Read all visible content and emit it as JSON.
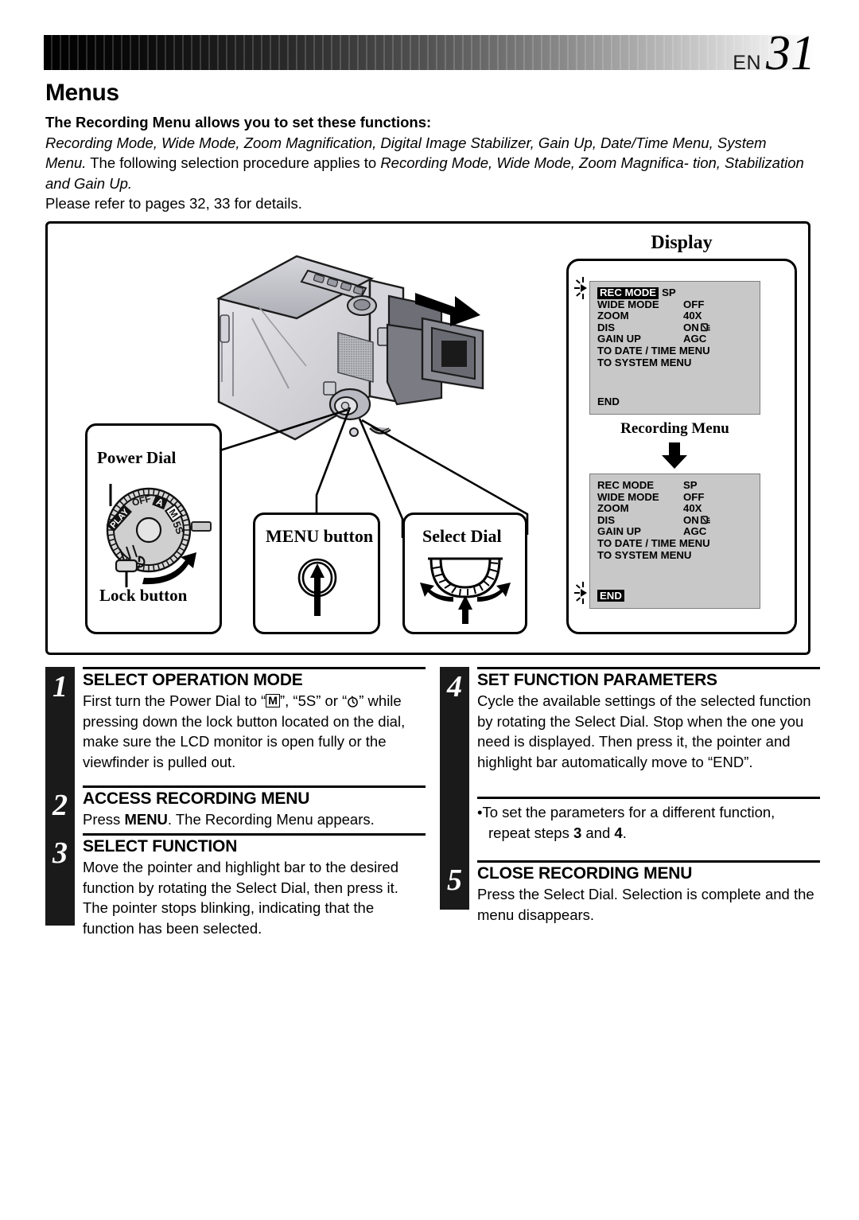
{
  "header": {
    "lang_code": "EN",
    "page_number": "31"
  },
  "page_title": "Menus",
  "intro": {
    "lead": "The Recording Menu allows you to set these functions:",
    "line1_italic": "Recording Mode, Wide Mode, Zoom Magnification, Digital Image Stabilizer, Gain Up, Date/Time Menu,",
    "line2_italic_a": "System Menu.",
    "line2_plain": " The following selection procedure applies to ",
    "line2_italic_b": "Recording Mode, Wide Mode, Zoom Magnifica-",
    "line3_italic": "tion, Stabilization and Gain Up.",
    "line4": "Please refer to pages 32, 33 for details."
  },
  "illustration": {
    "display_label": "Display",
    "recording_menu_caption": "Recording Menu",
    "callouts": {
      "power_dial": "Power Dial",
      "lock_button": "Lock button",
      "menu_button": "MENU button",
      "select_dial": "Select Dial"
    },
    "power_dial_positions": [
      "PLAY",
      "OFF",
      "A",
      "M",
      "5S"
    ],
    "power_dial_power_symbol": "power-icon"
  },
  "menu_screen_1": {
    "rows": [
      {
        "label": "REC MODE",
        "value": "SP",
        "highlighted": true,
        "wide": false
      },
      {
        "label": "WIDE MODE",
        "value": "OFF",
        "highlighted": false,
        "wide": false
      },
      {
        "label": "ZOOM",
        "value": "40X",
        "highlighted": false,
        "wide": false
      },
      {
        "label": "DIS",
        "value": "ON",
        "icon": "dis-hand-icon",
        "highlighted": false,
        "wide": false
      },
      {
        "label": "GAIN UP",
        "value": "AGC",
        "highlighted": false,
        "wide": false
      },
      {
        "label": "TO DATE / TIME MENU",
        "value": "",
        "highlighted": false,
        "wide": true
      },
      {
        "label": "TO SYSTEM MENU",
        "value": "",
        "highlighted": false,
        "wide": true
      }
    ],
    "end_label": "END",
    "end_highlighted": false,
    "pointer_on": "REC MODE"
  },
  "menu_screen_2": {
    "rows": [
      {
        "label": "REC MODE",
        "value": "SP",
        "highlighted": false,
        "wide": false
      },
      {
        "label": "WIDE MODE",
        "value": "OFF",
        "highlighted": false,
        "wide": false
      },
      {
        "label": "ZOOM",
        "value": "40X",
        "highlighted": false,
        "wide": false
      },
      {
        "label": "DIS",
        "value": "ON",
        "icon": "dis-hand-icon",
        "highlighted": false,
        "wide": false
      },
      {
        "label": "GAIN UP",
        "value": "AGC",
        "highlighted": false,
        "wide": false
      },
      {
        "label": "TO DATE / TIME MENU",
        "value": "",
        "highlighted": false,
        "wide": true
      },
      {
        "label": "TO SYSTEM MENU",
        "value": "",
        "highlighted": false,
        "wide": true
      }
    ],
    "end_label": "END",
    "end_highlighted": true,
    "pointer_on": "END"
  },
  "steps_left": [
    {
      "number": "1",
      "heading": "SELECT OPERATION MODE",
      "text_pre": "First turn the Power Dial to “",
      "text_mid1": "”, “5S” or “",
      "text_post": "” while pressing down the lock button located on the dial, make sure the LCD monitor is open fully or the viewfinder is pulled out.",
      "mode_box": "M"
    },
    {
      "number": "2",
      "heading": "ACCESS RECORDING MENU",
      "text_pre": "Press ",
      "bold_word": "MENU",
      "text_post": ". The Recording Menu appears."
    },
    {
      "number": "3",
      "heading": "SELECT FUNCTION",
      "text": "Move the pointer and highlight bar to the desired function by rotating the Select Dial, then press it. The pointer stops blinking, indicating that the function has been selected."
    }
  ],
  "steps_right": [
    {
      "number": "4",
      "heading": "SET FUNCTION PARAMETERS",
      "text": "Cycle the available settings of the selected function by rotating the Select Dial. Stop when the one you need is displayed. Then press it, the pointer and highlight bar automatically move to “END”."
    },
    {
      "number": "5",
      "heading": "CLOSE RECORDING MENU",
      "text": "Press the Select Dial. Selection is complete and the menu disappears."
    }
  ],
  "note": {
    "bullet": "•",
    "line1": "To set the parameters for a different function,",
    "line2_pre": "repeat steps ",
    "line2_b1": "3",
    "line2_mid": " and ",
    "line2_b2": "4",
    "line2_post": "."
  },
  "colors": {
    "ink": "#000000",
    "step_bar": "#1a1a1a",
    "menu_screen_bg": "#c8c8c8"
  }
}
